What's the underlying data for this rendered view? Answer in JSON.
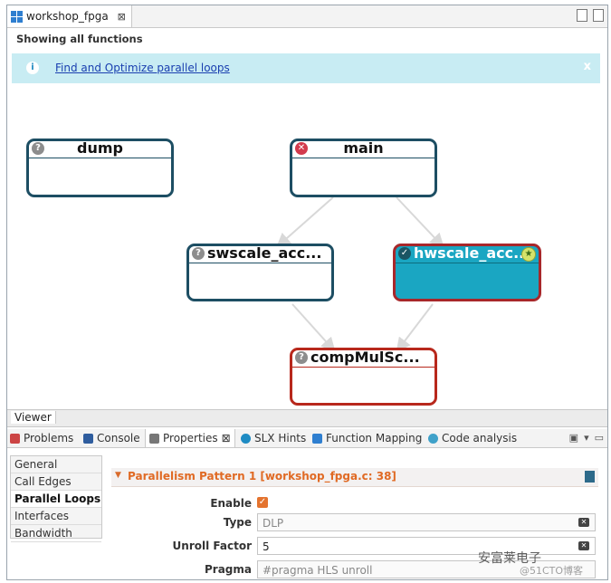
{
  "editor": {
    "tab_title": "workshop_fpga",
    "tab_close": "⊠",
    "showing_label": "Showing all functions"
  },
  "infobar": {
    "icon": "i",
    "link_text": "Find and Optimize parallel loops",
    "close_text": "x"
  },
  "graph": {
    "nodes": {
      "dump": {
        "label": "dump",
        "status": "unknown"
      },
      "main": {
        "label": "main",
        "status": "error"
      },
      "swscale": {
        "label": "swscale_acc...",
        "status": "unknown"
      },
      "hwscale": {
        "label": "hwscale_acc...",
        "status": "accelerated"
      },
      "compmul": {
        "label": "compMulSc...",
        "status": "unknown"
      }
    },
    "badge_glyphs": {
      "unknown": "?",
      "error": "✕",
      "ok": "✓",
      "star": "★"
    },
    "colors": {
      "node_border": "#1d4e63",
      "accel_fill": "#1aa6c2",
      "accel_border": "#a8272a",
      "red_border": "#b8281c"
    }
  },
  "viewer_label": "Viewer",
  "panel_tabs": [
    {
      "label": "Problems",
      "icon": "problems-icon"
    },
    {
      "label": "Console",
      "icon": "console-icon"
    },
    {
      "label": "Properties",
      "icon": "properties-icon",
      "close": "⊠"
    },
    {
      "label": "SLX Hints",
      "icon": "hints-icon"
    },
    {
      "label": "Function Mapping",
      "icon": "mapping-icon"
    },
    {
      "label": "Code analysis",
      "icon": "analysis-icon"
    }
  ],
  "side_categories": [
    "General",
    "Call Edges",
    "Parallel Loops",
    "Interfaces",
    "Bandwidth"
  ],
  "properties": {
    "section_title": "Parallelism Pattern 1 [workshop_fpga.c: 38]",
    "enable_label": "Enable",
    "enable_checked": true,
    "type_label": "Type",
    "type_value": "DLP",
    "unroll_label": "Unroll Factor",
    "unroll_value": "5",
    "pragma_label": "Pragma",
    "pragma_value": "#pragma HLS unroll"
  },
  "watermark": {
    "text": "安富莱电子",
    "sub": "@51CTO博客"
  }
}
